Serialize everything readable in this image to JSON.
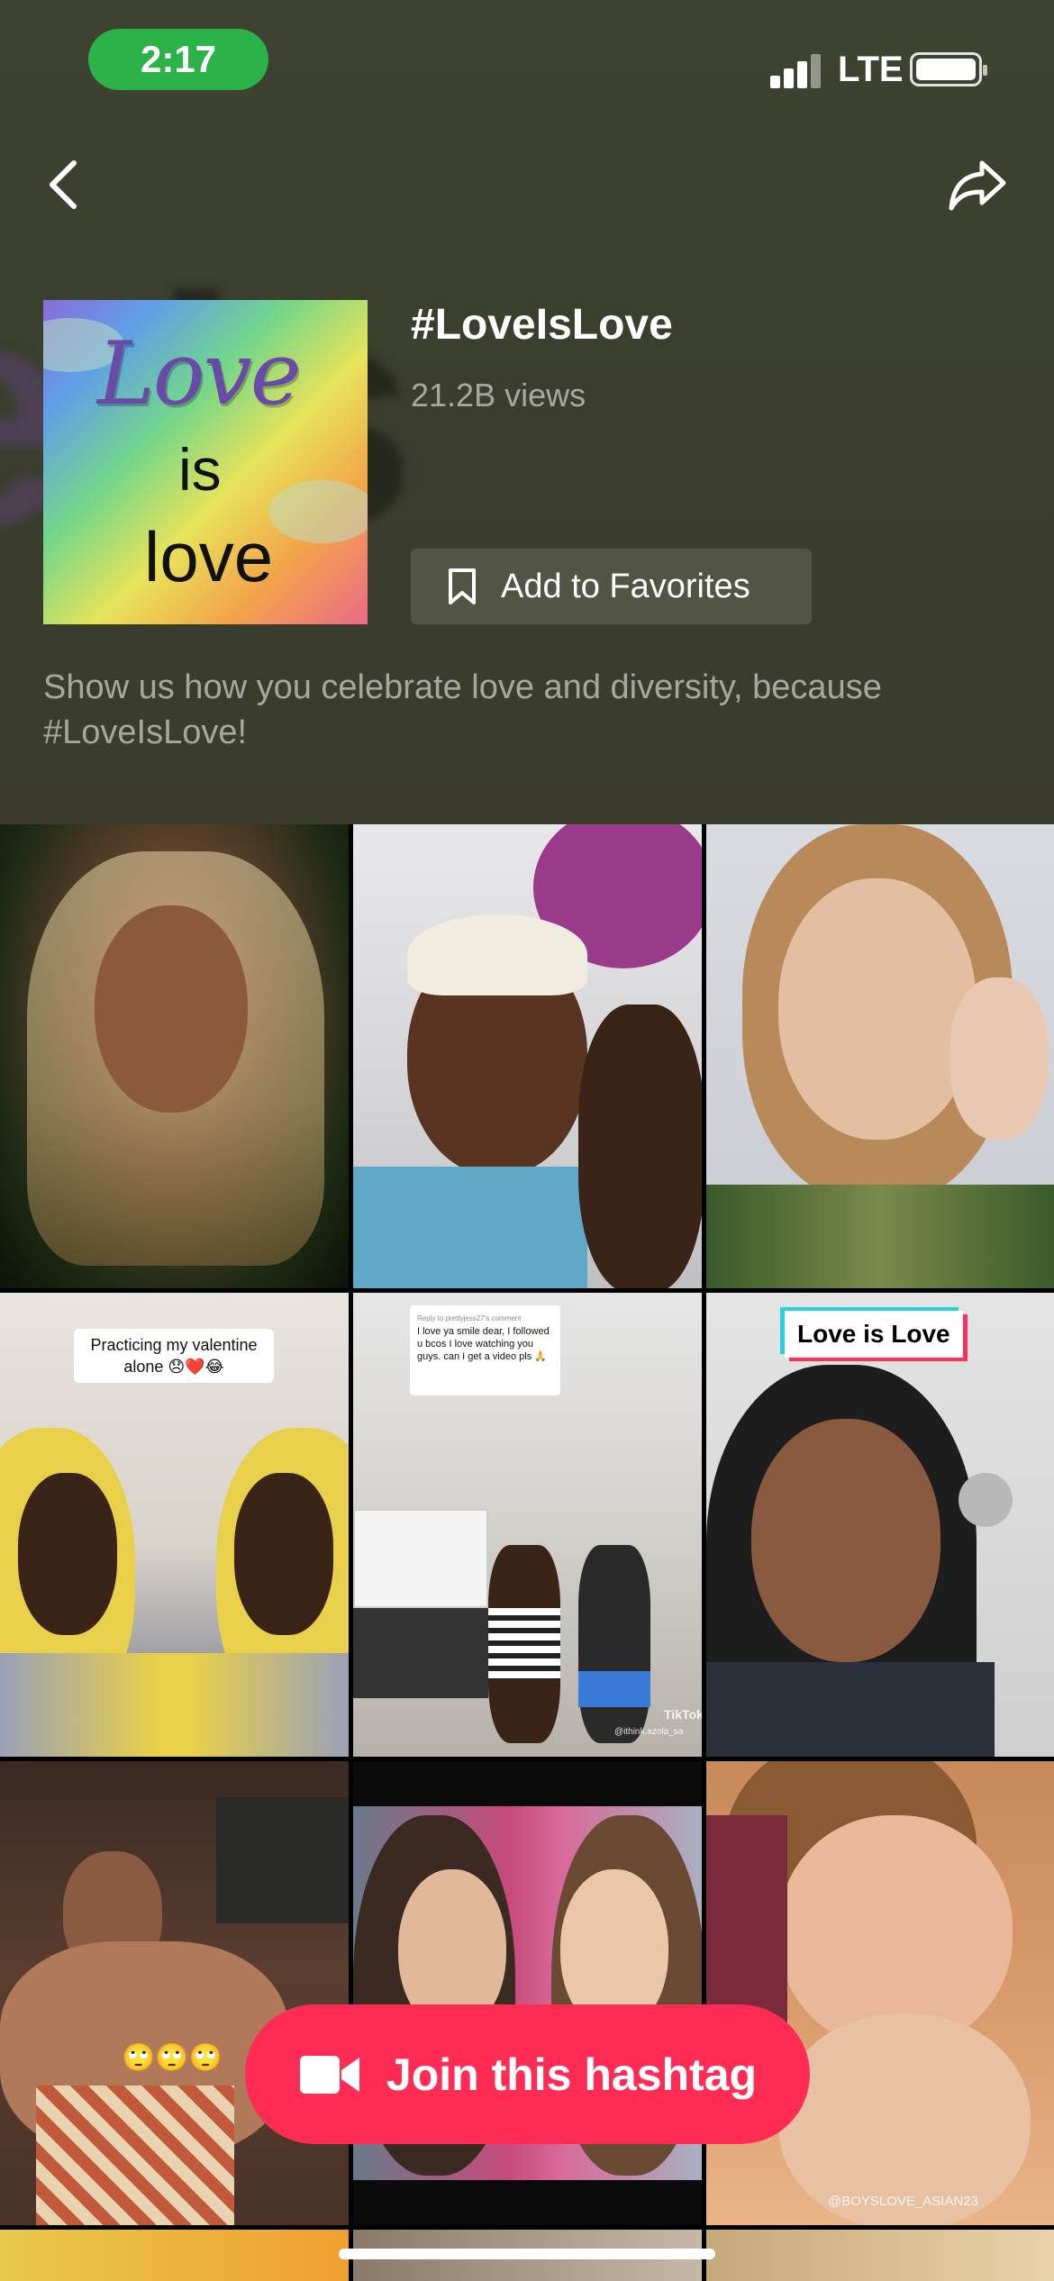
{
  "status_bar": {
    "time": "2:17",
    "network": "LTE"
  },
  "nav": {
    "back_icon": "chevron-left-icon",
    "share_icon": "share-arrow-icon"
  },
  "hashtag": {
    "cover_text": [
      "Love",
      "is",
      "love"
    ],
    "title": "#LoveIsLove",
    "views": "21.2B views",
    "favorite_label": "Add to Favorites",
    "description": "Show us how you celebrate love and diversity, because #LoveIsLove!"
  },
  "videos": [
    {
      "overlay": ""
    },
    {
      "overlay": ""
    },
    {
      "overlay": ""
    },
    {
      "overlay": "Practicing my valentine alone 😞❤️😂"
    },
    {
      "overlay": "I love ya smile dear, I followed u bcos I love watching you guys. can I get a video pls 🙏",
      "reply_label": "Reply to prettyjess27's comment",
      "watermark": "TikTok",
      "handle": "@ithink.azola_sa"
    },
    {
      "overlay": "Love is Love"
    },
    {
      "overlay": "🙄🙄🙄"
    },
    {
      "overlay": ""
    },
    {
      "overlay": "",
      "watermark": "@BOYSLOVE_ASIAN23"
    }
  ],
  "cta": {
    "join_label": "Join this hashtag",
    "icon": "video-camera-icon"
  },
  "colors": {
    "accent": "#fe2c55",
    "status_pill": "#2bb34a",
    "header_bg": "#3b3f2e"
  }
}
